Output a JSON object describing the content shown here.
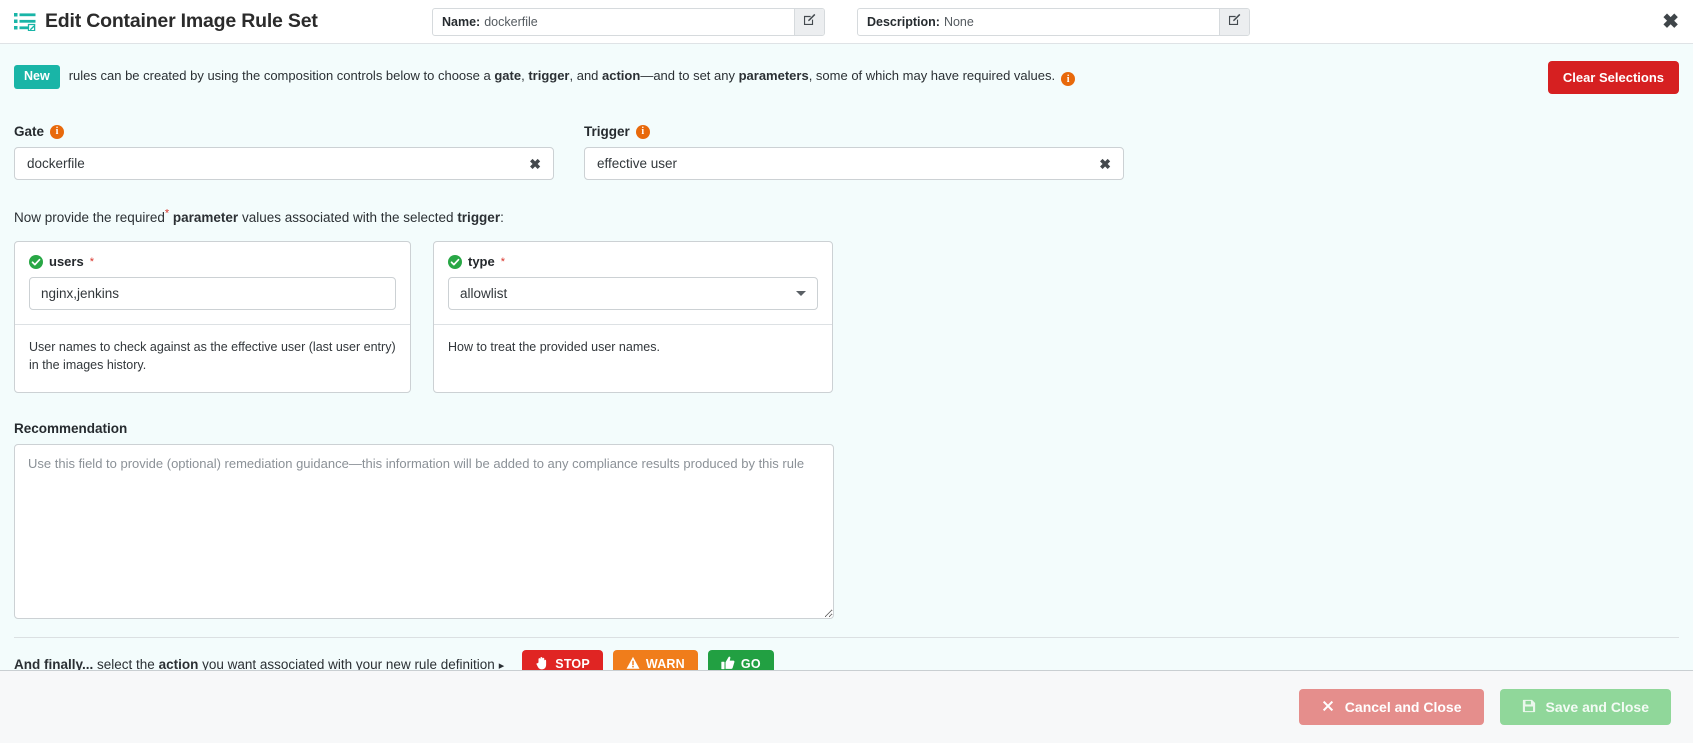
{
  "header": {
    "title": "Edit Container Image Rule Set",
    "icon": "list-edit-icon",
    "name_field": {
      "label": "Name:",
      "value": "dockerfile",
      "edit_icon": "pencil-square-icon"
    },
    "description_field": {
      "label": "Description:",
      "value": "None",
      "edit_icon": "pencil-square-icon"
    },
    "close_label": "✖"
  },
  "banner": {
    "badge": "New",
    "text_1": "rules can be created by using the composition controls below to choose a ",
    "bold_1": "gate",
    "text_2": ", ",
    "bold_2": "trigger",
    "text_3": ", and ",
    "bold_3": "action",
    "text_4": "—and to set any ",
    "bold_4": "parameters",
    "text_5": ", some of which may have required values.",
    "info_icon": "i",
    "clear_button": "Clear Selections"
  },
  "gate": {
    "label": "Gate",
    "info_icon": "i",
    "value": "dockerfile",
    "clear": "✖"
  },
  "trigger": {
    "label": "Trigger",
    "info_icon": "i",
    "value": "effective user",
    "clear": "✖"
  },
  "params": {
    "intro_1": "Now provide the required",
    "intro_star": "*",
    "intro_2": " ",
    "intro_bold_1": "parameter",
    "intro_3": " values associated with the selected ",
    "intro_bold_2": "trigger",
    "intro_4": ":",
    "items": [
      {
        "name": "users",
        "required": "*",
        "control": "text",
        "value": "nginx,jenkins",
        "help": "User names to check against as the effective user (last user entry) in the images history."
      },
      {
        "name": "type",
        "required": "*",
        "control": "select",
        "value": "allowlist",
        "help": "How to treat the provided user names."
      }
    ]
  },
  "recommendation": {
    "label": "Recommendation",
    "value": "",
    "placeholder": "Use this field to provide (optional) remediation guidance—this information will be added to any compliance results produced by this rule"
  },
  "final": {
    "bold_prefix": "And finally...",
    "text_1": " select the ",
    "bold_1": "action",
    "text_2": " you want associated with your new rule definition",
    "arrow": "▸",
    "actions": [
      {
        "label": "STOP",
        "icon": "hand-icon",
        "color": "#e02523"
      },
      {
        "label": "WARN",
        "icon": "warning-triangle-icon",
        "color": "#f07d1b"
      },
      {
        "label": "GO",
        "icon": "thumbs-up-icon",
        "color": "#22a042"
      }
    ]
  },
  "footer": {
    "cancel_label": "Cancel and Close",
    "cancel_icon": "x-icon",
    "save_label": "Save and Close",
    "save_icon": "floppy-disk-icon"
  },
  "colors": {
    "brand_teal": "#19b5a7",
    "danger_red": "#d62021",
    "info_orange": "#e8690b",
    "success_green": "#22a042",
    "warn_orange": "#f07d1b",
    "page_bg": "#f3fcfc",
    "footer_bg": "#f7f8f9"
  }
}
